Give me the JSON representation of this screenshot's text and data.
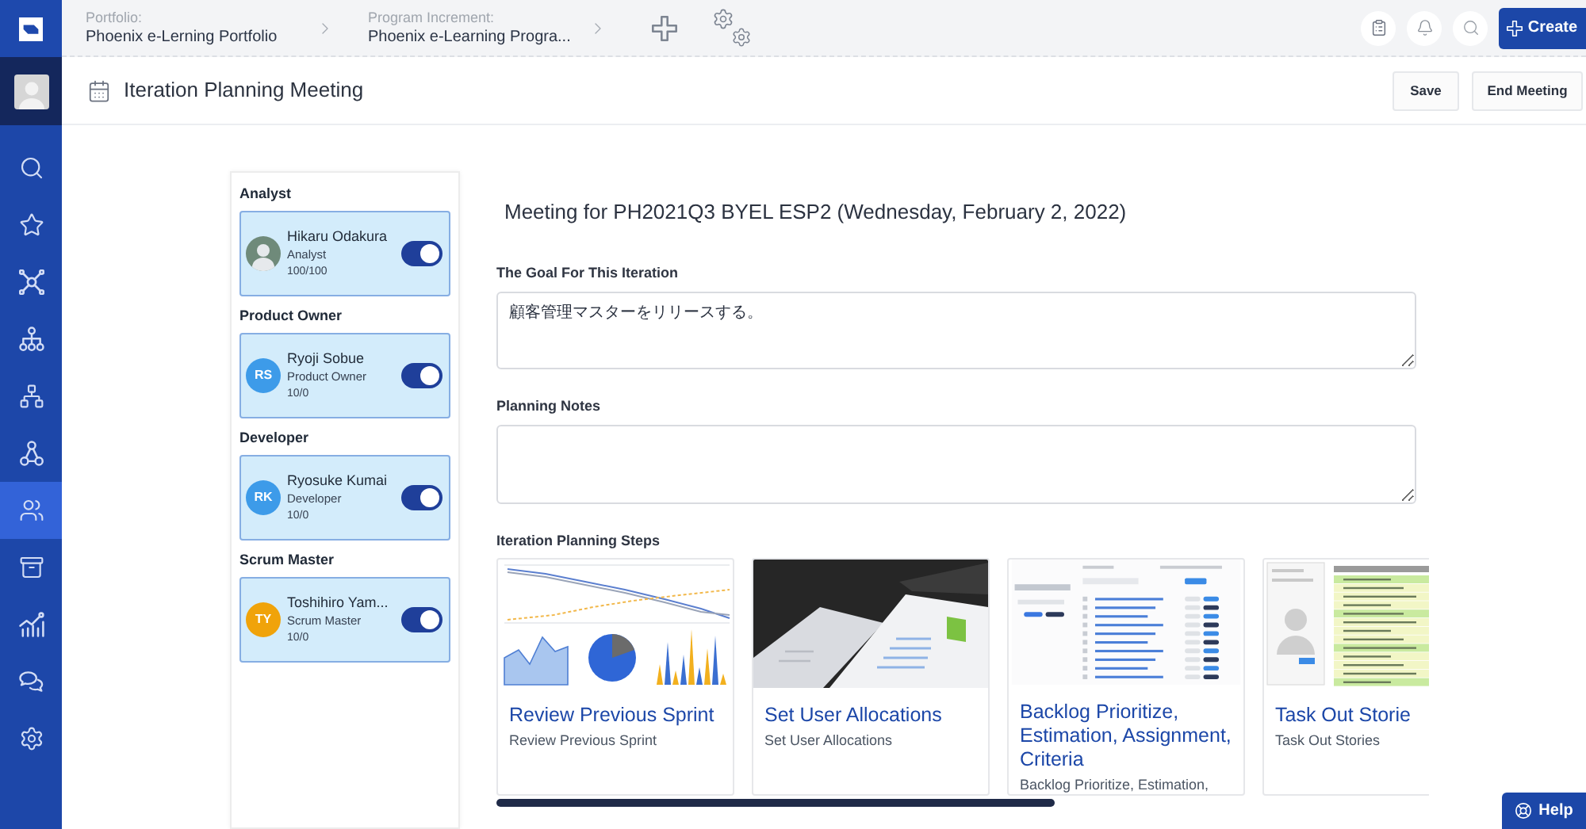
{
  "sidebar": {
    "items": [
      {
        "kind": "search",
        "selected": false
      },
      {
        "kind": "star",
        "selected": false
      },
      {
        "kind": "hub",
        "selected": false
      },
      {
        "kind": "tree",
        "selected": false
      },
      {
        "kind": "org",
        "selected": false
      },
      {
        "kind": "nodes",
        "selected": false
      },
      {
        "kind": "team",
        "selected": true
      },
      {
        "kind": "archive",
        "selected": false
      },
      {
        "kind": "chart",
        "selected": false
      },
      {
        "kind": "chat",
        "selected": false
      },
      {
        "kind": "settings",
        "selected": false
      }
    ]
  },
  "top_bar": {
    "breadcrumbs": [
      {
        "label": "Portfolio:",
        "value": "Phoenix e-Lerning Portfolio"
      },
      {
        "label": "Program Increment:",
        "value": "Phoenix e-Learning Progra..."
      }
    ],
    "create_button": "Create"
  },
  "page_header": {
    "title": "Iteration Planning Meeting",
    "buttons": [
      "Save",
      "End Meeting"
    ]
  },
  "members": {
    "groups": [
      {
        "heading": "Analyst",
        "member": {
          "name": "Hikaru Odakura",
          "role": "Analyst",
          "allocation": "100/100",
          "avatar": {
            "kind": "photo"
          },
          "on": true
        }
      },
      {
        "heading": "Product Owner",
        "member": {
          "name": "Ryoji Sobue",
          "role": "Product Owner",
          "allocation": "10/0",
          "avatar": {
            "kind": "initials",
            "initials": "RS",
            "color": "#3d9be9"
          },
          "on": true
        }
      },
      {
        "heading": "Developer",
        "member": {
          "name": "Ryosuke Kumai",
          "role": "Developer",
          "allocation": "10/0",
          "avatar": {
            "kind": "initials",
            "initials": "RK",
            "color": "#3d9be9"
          },
          "on": true
        }
      },
      {
        "heading": "Scrum Master",
        "member": {
          "name": "Toshihiro Yam...",
          "role": "Scrum Master",
          "allocation": "10/0",
          "avatar": {
            "kind": "initials",
            "initials": "TY",
            "color": "#f0a30a"
          },
          "on": true
        }
      }
    ]
  },
  "meeting": {
    "title": "Meeting for PH2021Q3 BYEL ESP2 (Wednesday, February 2, 2022)",
    "goal": {
      "label": "The Goal For This Iteration",
      "value": "顧客管理マスターをリリースする。"
    },
    "notes": {
      "label": "Planning Notes"
    },
    "steps": {
      "label": "Iteration Planning Steps",
      "cards": [
        {
          "kind": "charts",
          "title": "Review Previous Sprint",
          "subtitle": "Review Previous Sprint"
        },
        {
          "kind": "photo",
          "title": "Set User Allocations",
          "subtitle": "Set User Allocations"
        },
        {
          "kind": "backlog",
          "title": "Backlog Prioritize, Estimation, Assignment, Criteria",
          "subtitle": "Backlog Prioritize, Estimation,"
        },
        {
          "kind": "taskboard",
          "title": "Task Out Storie",
          "subtitle": "Task Out Stories"
        }
      ]
    }
  },
  "help_button": "Help"
}
